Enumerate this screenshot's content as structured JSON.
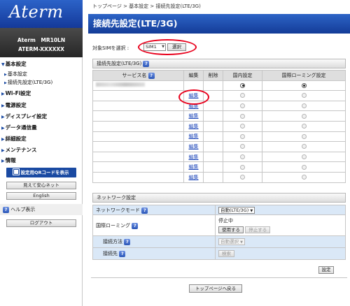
{
  "sidebar": {
    "logo": "Aterm",
    "model_line1": "Aterm　MR10LN",
    "model_line2": "ATERM-XXXXXX",
    "menu": [
      {
        "label": "基本設定"
      },
      {
        "label": "Wi-Fi設定"
      },
      {
        "label": "電源設定"
      },
      {
        "label": "ディスプレイ設定"
      },
      {
        "label": "データ通信量"
      },
      {
        "label": "詳細設定"
      },
      {
        "label": "メンテナンス"
      },
      {
        "label": "情報"
      }
    ],
    "submenu": [
      "基本設定",
      "接続先設定(LTE/3G)"
    ],
    "qr_button": "設定用QRコードを表示",
    "mieru_button": "見えて安心ネット",
    "english_button": "English",
    "help_label": "ヘルプ表示",
    "logout_button": "ログアウト"
  },
  "breadcrumb": "トップページ > 基本設定 > 接続先設定(LTE/3G)",
  "page_title": "接続先設定(LTE/3G)",
  "sim": {
    "label": "対象SIMを選択 :",
    "selected": "SIM1",
    "button": "選択"
  },
  "apn_section": {
    "title": "接続先設定(LTE/3G)",
    "headers": [
      "サービス名",
      "編集",
      "削除",
      "国内設定",
      "国際ローミング設定"
    ],
    "edit_label": "編集",
    "rows": [
      {
        "edit": false,
        "domestic_on": true,
        "roaming_on": true
      },
      {
        "edit": true,
        "domestic_on": false,
        "roaming_on": false
      },
      {
        "edit": true,
        "domestic_on": false,
        "roaming_on": false
      },
      {
        "edit": true,
        "domestic_on": false,
        "roaming_on": false
      },
      {
        "edit": true,
        "domestic_on": false,
        "roaming_on": false
      },
      {
        "edit": true,
        "domestic_on": false,
        "roaming_on": false
      },
      {
        "edit": true,
        "domestic_on": false,
        "roaming_on": false
      },
      {
        "edit": true,
        "domestic_on": false,
        "roaming_on": false
      },
      {
        "edit": true,
        "domestic_on": false,
        "roaming_on": false
      },
      {
        "edit": true,
        "domestic_on": false,
        "roaming_on": false
      }
    ]
  },
  "network_section": {
    "title": "ネットワーク設定",
    "mode_label": "ネットワークモード",
    "mode_value": "自動(LTE/3G)",
    "roaming_label": "国際ローミング",
    "roaming_status": "停止中",
    "use_button": "使用する",
    "stop_button": "停止する",
    "method_label": "接続方法",
    "method_value": "自動選択",
    "dest_label": "接続先",
    "search_button": "検索"
  },
  "set_button": "設定",
  "top_button": "トップページへ戻る",
  "colors": {
    "brand": "#1a4aa2",
    "highlight": "#e8001c",
    "link": "#1a44b8",
    "row_blue": "#dae8f7"
  }
}
